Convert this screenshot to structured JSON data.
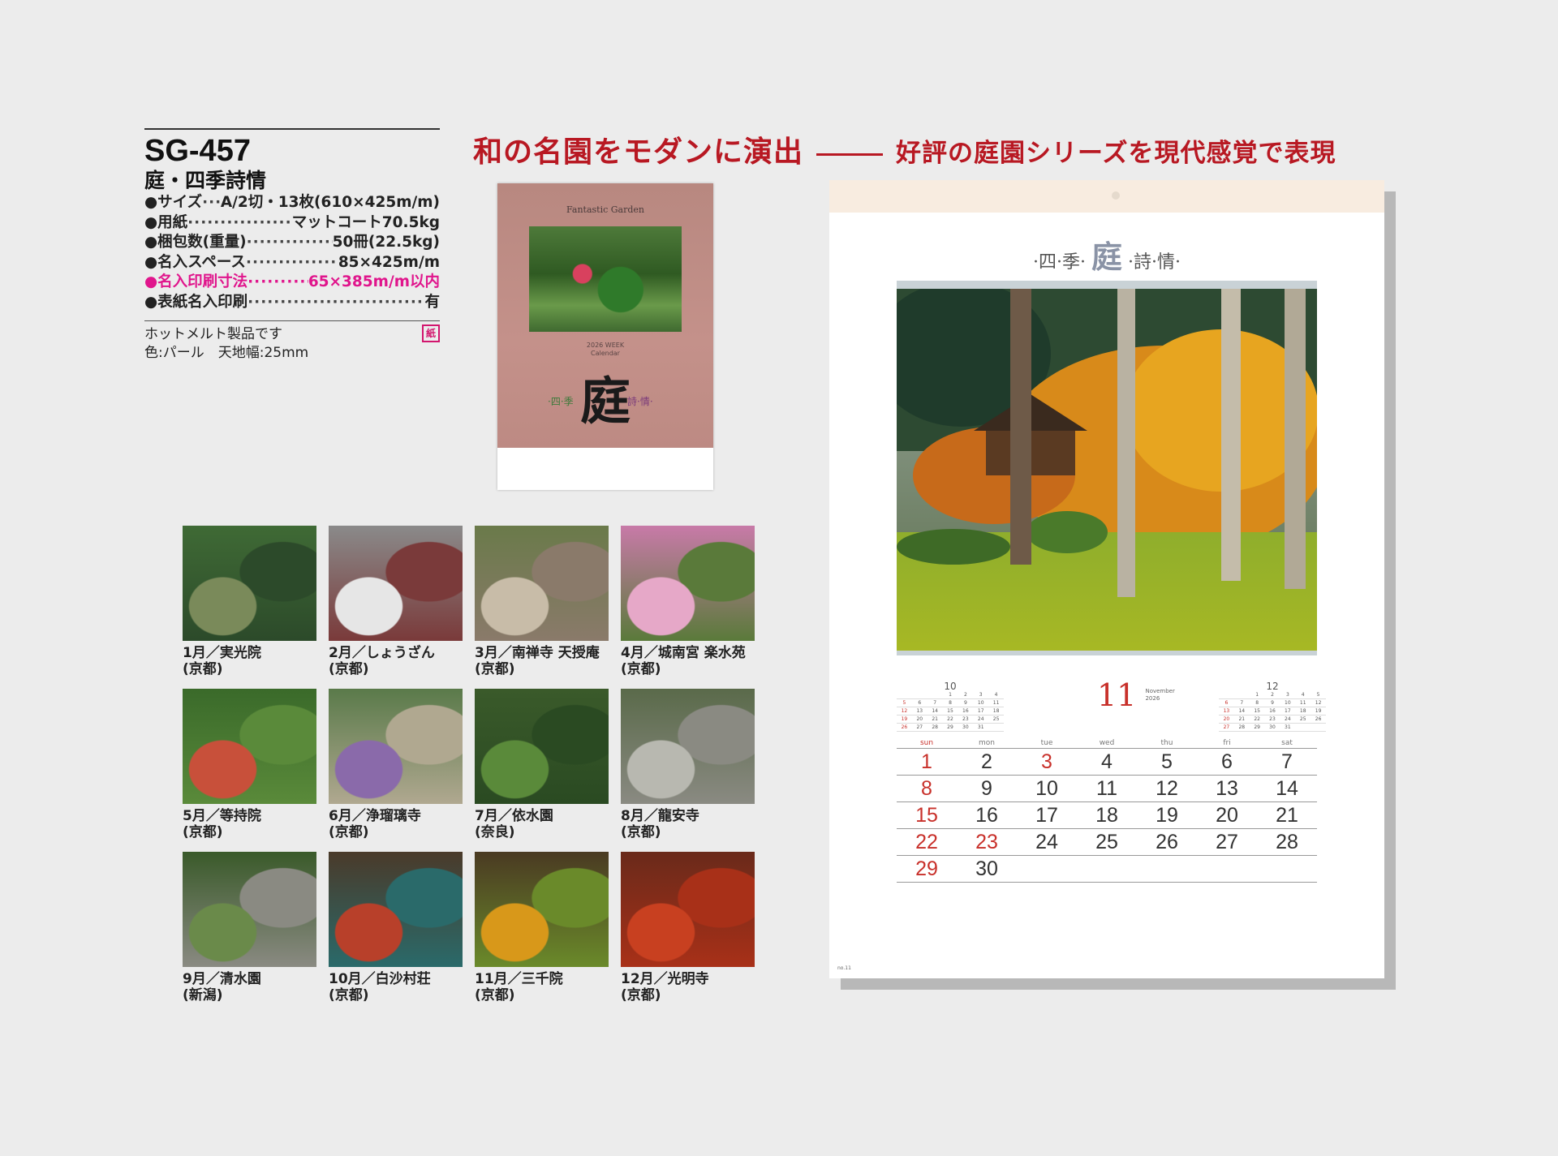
{
  "product": {
    "model": "SG-457",
    "name": "庭・四季詩情",
    "specs": [
      {
        "label": "●サイズ",
        "value": "A/2切・13枚(610×425m/m)",
        "highlight": false
      },
      {
        "label": "●用紙",
        "value": "マットコート70.5kg",
        "highlight": false
      },
      {
        "label": "●梱包数(重量)",
        "value": "50冊(22.5kg)",
        "highlight": false
      },
      {
        "label": "●名入スペース",
        "value": "85×425m/m",
        "highlight": false
      },
      {
        "label": "●名入印刷寸法",
        "value": "65×385m/m以内",
        "highlight": true
      },
      {
        "label": "●表紙名入印刷",
        "value": "有",
        "highlight": false
      }
    ],
    "note_line1": "ホットメルト製品です",
    "note_badge": "紙",
    "note_line2": "色:パール　天地幅:25mm"
  },
  "headline": {
    "main": "和の名園をモダンに演出",
    "sub": "好評の庭園シリーズを現代感覚で表現"
  },
  "cover": {
    "title": "Fantastic Garden",
    "year_line1": "2026 WEEK",
    "year_line2": "Calendar",
    "kanji": "庭",
    "left_chars": "·四·季",
    "right_chars": "詩·情·"
  },
  "months": [
    {
      "month": "1月／実光院",
      "place": "(京都)"
    },
    {
      "month": "2月／しょうざん",
      "place": "(京都)"
    },
    {
      "month": "3月／南禅寺 天授庵",
      "place": "(京都)"
    },
    {
      "month": "4月／城南宮 楽水苑",
      "place": "(京都)"
    },
    {
      "month": "5月／等持院",
      "place": "(京都)"
    },
    {
      "month": "6月／浄瑠璃寺",
      "place": "(京都)"
    },
    {
      "month": "7月／依水園",
      "place": "(奈良)"
    },
    {
      "month": "8月／龍安寺",
      "place": "(京都)"
    },
    {
      "month": "9月／清水園",
      "place": "(新潟)"
    },
    {
      "month": "10月／白沙村荘",
      "place": "(京都)"
    },
    {
      "month": "11月／三千院",
      "place": "(京都)"
    },
    {
      "month": "12月／光明寺",
      "place": "(京都)"
    }
  ],
  "calendar": {
    "logo_left": "·四·季·",
    "logo_kanji": "庭",
    "logo_right": "·詩·情·",
    "month_number": "11",
    "month_name": "November",
    "month_year": "2026",
    "page_no": "no.11",
    "weekdays": [
      "sun",
      "mon",
      "tue",
      "wed",
      "thu",
      "fri",
      "sat"
    ],
    "weeks": [
      [
        "1",
        "2",
        "3",
        "4",
        "5",
        "6",
        "7"
      ],
      [
        "8",
        "9",
        "10",
        "11",
        "12",
        "13",
        "14"
      ],
      [
        "15",
        "16",
        "17",
        "18",
        "19",
        "20",
        "21"
      ],
      [
        "22",
        "23",
        "24",
        "25",
        "26",
        "27",
        "28"
      ],
      [
        "29",
        "30",
        "",
        "",
        "",
        "",
        ""
      ]
    ],
    "red_days": [
      "1",
      "3",
      "8",
      "15",
      "22",
      "23",
      "29"
    ],
    "prev_month": {
      "label": "10",
      "days": [
        "",
        "",
        "",
        "1",
        "2",
        "3",
        "4",
        "5",
        "6",
        "7",
        "8",
        "9",
        "10",
        "11",
        "12",
        "13",
        "14",
        "15",
        "16",
        "17",
        "18",
        "19",
        "20",
        "21",
        "22",
        "23",
        "24",
        "25",
        "26",
        "27",
        "28",
        "29",
        "30",
        "31",
        ""
      ]
    },
    "next_month": {
      "label": "12",
      "days": [
        "",
        "",
        "1",
        "2",
        "3",
        "4",
        "5",
        "6",
        "7",
        "8",
        "9",
        "10",
        "11",
        "12",
        "13",
        "14",
        "15",
        "16",
        "17",
        "18",
        "19",
        "20",
        "21",
        "22",
        "23",
        "24",
        "25",
        "26",
        "27",
        "28",
        "29",
        "30",
        "31",
        "",
        ""
      ]
    }
  }
}
